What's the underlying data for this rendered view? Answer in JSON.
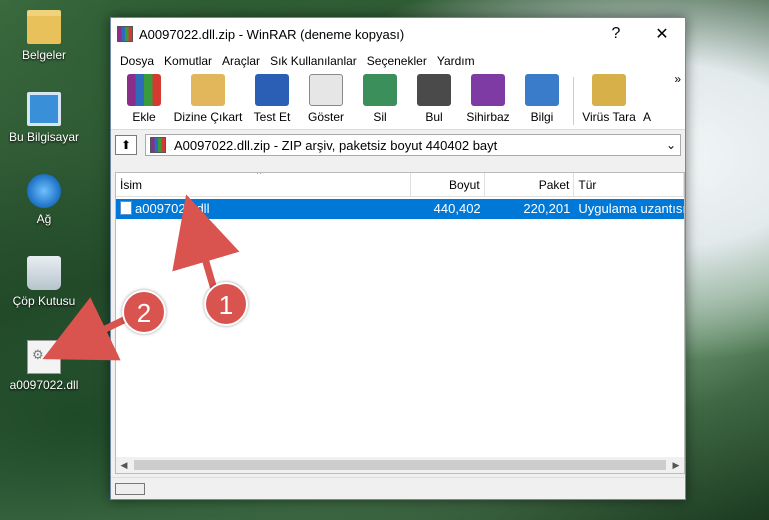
{
  "desktop": {
    "icons": [
      {
        "label": "Belgeler",
        "icon": "folder-icon"
      },
      {
        "label": "Bu Bilgisayar",
        "icon": "computer-icon"
      },
      {
        "label": "Ağ",
        "icon": "network-icon"
      },
      {
        "label": "Çöp Kutusu",
        "icon": "recycle-bin-icon"
      },
      {
        "label": "a0097022.dll",
        "icon": "dll-file-icon"
      }
    ]
  },
  "window": {
    "title": "A0097022.dll.zip - WinRAR (deneme kopyası)",
    "help": "?",
    "close": "✕"
  },
  "menu": [
    "Dosya",
    "Komutlar",
    "Araçlar",
    "Sık Kullanılanlar",
    "Seçenekler",
    "Yardım"
  ],
  "toolbar": {
    "buttons": [
      {
        "label": "Ekle",
        "color": "#c03a2b"
      },
      {
        "label": "Dizine Çıkart",
        "color": "#d9a441"
      },
      {
        "label": "Test Et",
        "color": "#2b5fb5"
      },
      {
        "label": "Göster",
        "color": "#a0a0a0"
      },
      {
        "label": "Sil",
        "color": "#3a8f5a"
      },
      {
        "label": "Bul",
        "color": "#4a4a4a"
      },
      {
        "label": "Sihirbaz",
        "color": "#7d3ba3"
      },
      {
        "label": "Bilgi",
        "color": "#3a7cc9"
      },
      {
        "label": "Virüs Tara",
        "color": "#d8b04a"
      },
      {
        "label": "A",
        "color": "#ffffff"
      }
    ],
    "more": "»"
  },
  "path": {
    "up": "⬆",
    "text": "A0097022.dll.zip - ZIP arşiv, paketsiz boyut 440402 bayt",
    "dropdown": "⌄"
  },
  "list": {
    "columns": [
      "İsim",
      "Boyut",
      "Paket",
      "Tür"
    ],
    "sort_indicator": "^",
    "rows": [
      {
        "name": "a0097022.dll",
        "size": "440,402",
        "packed": "220,201",
        "type": "Uygulama uzantısı"
      }
    ]
  },
  "annotations": {
    "badge1": "1",
    "badge2": "2",
    "color": "#d9534f"
  }
}
